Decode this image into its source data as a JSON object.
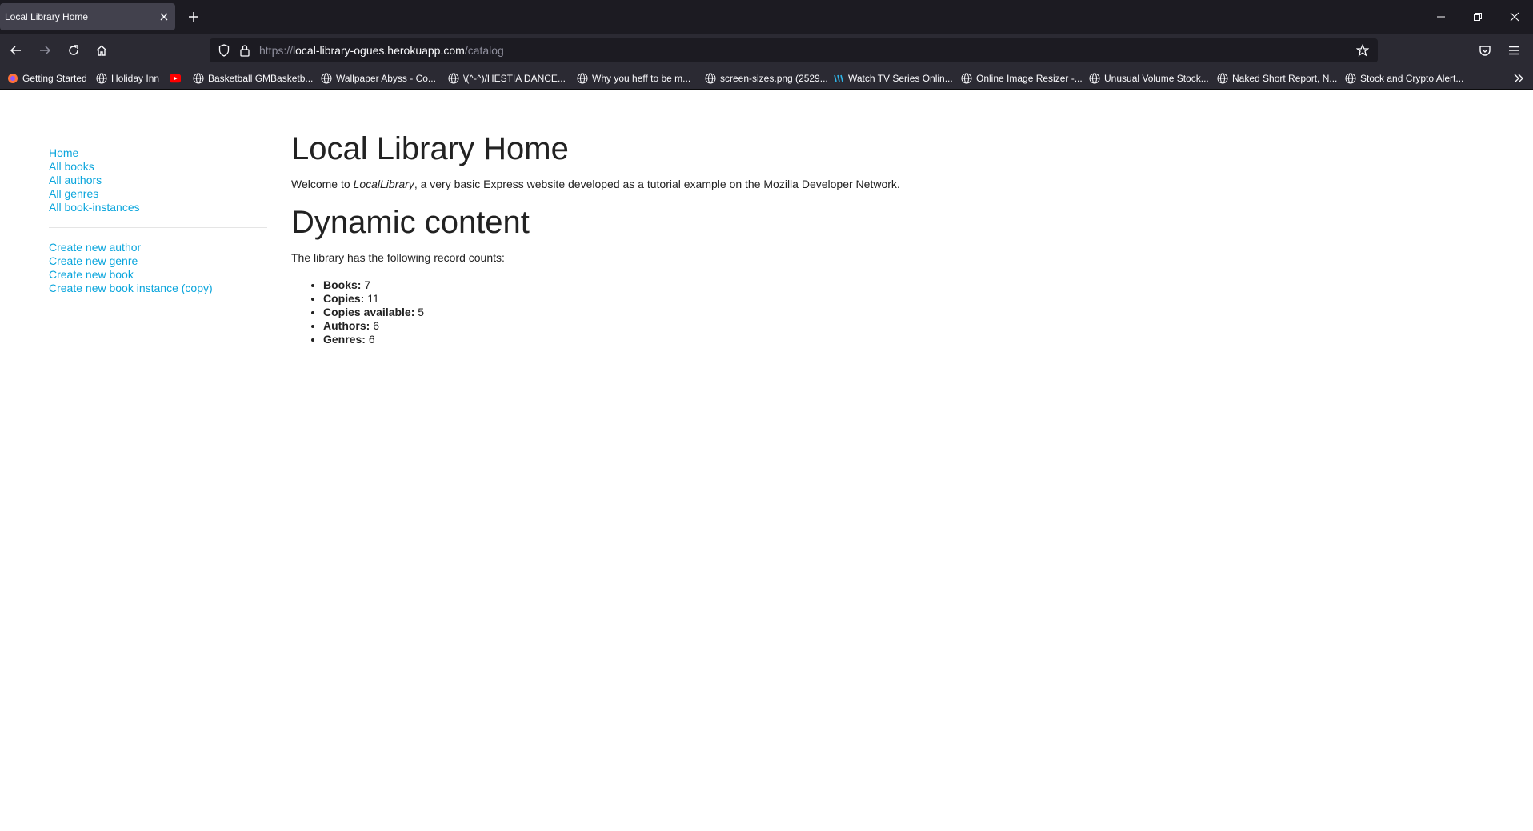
{
  "browser": {
    "tab_title": "Local Library Home",
    "url_prefix": "https://",
    "url_host": "local-library-ogues.herokuapp.com",
    "url_path": "/catalog",
    "bookmarks": [
      {
        "label": "Getting Started",
        "icon": "firefox-icon"
      },
      {
        "label": "Holiday Inn",
        "icon": "globe-icon"
      },
      {
        "label": "",
        "icon": "youtube-icon"
      },
      {
        "label": "Basketball GMBasketb...",
        "icon": "globe-icon"
      },
      {
        "label": "Wallpaper Abyss - Co...",
        "icon": "globe-icon"
      },
      {
        "label": "\\(^-^)/HESTIA DANCE...",
        "icon": "globe-icon"
      },
      {
        "label": "Why you heff to be m...",
        "icon": "globe-icon"
      },
      {
        "label": "screen-sizes.png (2529...",
        "icon": "globe-icon"
      },
      {
        "label": "Watch TV Series Onlin...",
        "icon": "tv-icon"
      },
      {
        "label": "Online Image Resizer -...",
        "icon": "globe-icon"
      },
      {
        "label": "Unusual Volume Stock...",
        "icon": "globe-icon"
      },
      {
        "label": "Naked Short Report, N...",
        "icon": "globe-icon"
      },
      {
        "label": "Stock and Crypto Alert...",
        "icon": "globe-icon"
      }
    ]
  },
  "sidebar": {
    "links": [
      "Home",
      "All books",
      "All authors",
      "All genres",
      "All book-instances"
    ],
    "create_links": [
      "Create new author",
      "Create new genre",
      "Create new book",
      "Create new book instance (copy)"
    ]
  },
  "main": {
    "title": "Local Library Home",
    "welcome_prefix": "Welcome to ",
    "welcome_em": "LocalLibrary",
    "welcome_suffix": ", a very basic Express website developed as a tutorial example on the Mozilla Developer Network.",
    "dynamic_heading": "Dynamic content",
    "counts_intro": "The library has the following record counts:",
    "counts": [
      {
        "label": "Books:",
        "value": "7"
      },
      {
        "label": "Copies:",
        "value": "11"
      },
      {
        "label": "Copies available:",
        "value": "5"
      },
      {
        "label": "Authors:",
        "value": "6"
      },
      {
        "label": "Genres:",
        "value": "6"
      }
    ]
  },
  "colors": {
    "link": "#0aa5dc",
    "chrome_dark": "#1c1b22",
    "chrome": "#2b2a33"
  }
}
